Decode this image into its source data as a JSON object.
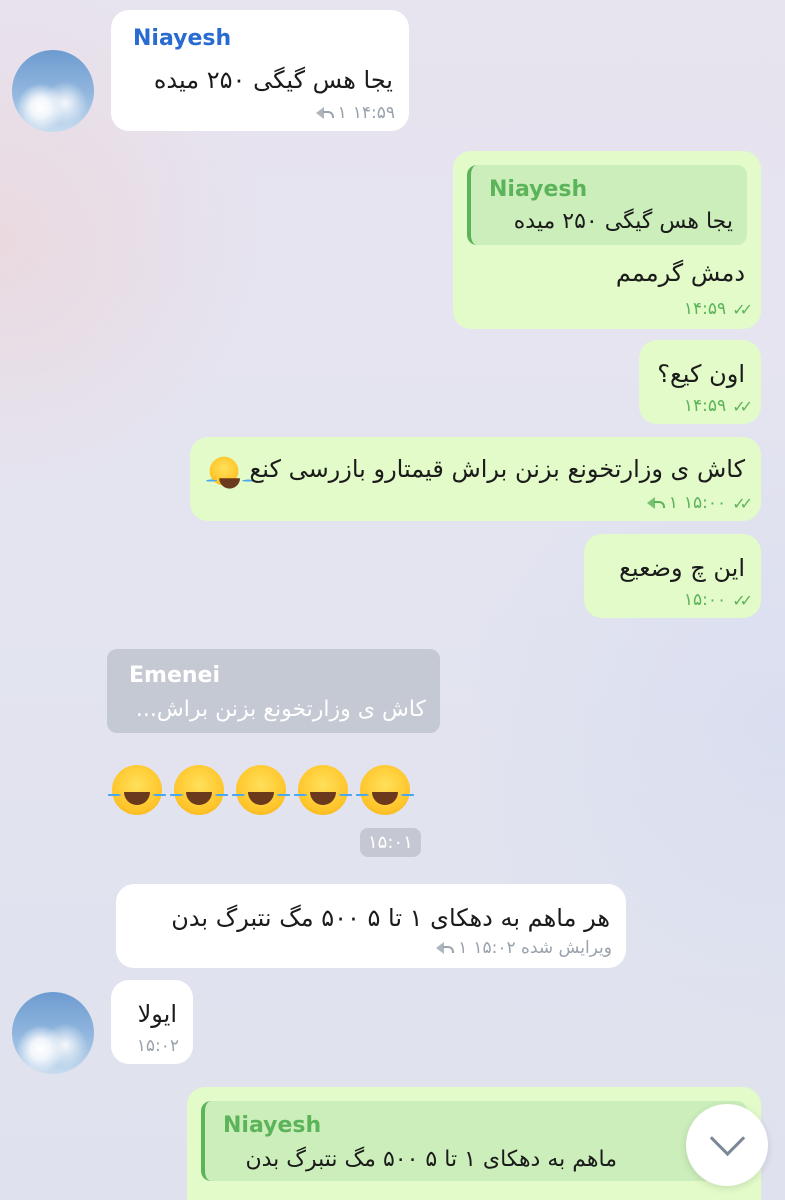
{
  "colors": {
    "incoming_bg": "#ffffff",
    "outgoing_bg": "#e2fbc8",
    "sender_name": "#2a6bd1",
    "quote_green": "#5cb45a"
  },
  "messages": [
    {
      "sender": "Niayesh",
      "text": "یجا هس گیگی ۲۵۰ میده",
      "meta": "۱۴:۵۹",
      "replies": "۱"
    },
    {
      "quote": {
        "name": "Niayesh",
        "text": "یجا هس گیگی ۲۵۰ میده"
      },
      "text": "دمش گرممم",
      "meta": "۱۴:۵۹"
    },
    {
      "text": "اون کیع؟",
      "meta": "۱۴:۵۹"
    },
    {
      "text": "کاش ی وزارتخونع بزنن براش قیمتارو بازرسی کنع",
      "meta": "۱۵:۰۰",
      "replies": "۱"
    },
    {
      "text": "این چ وضعیع",
      "meta": "۱۵:۰۰"
    },
    {
      "quote": {
        "name": "Emenei",
        "text": "کاش ی وزارتخونع بزنن براش..."
      },
      "emoji_count": 5,
      "meta": "۱۵:۰۱"
    },
    {
      "text": "هر ماهم به دهکای ۱ تا ۵  ۵۰۰ مگ نتبرگ بدن",
      "meta": "ویرایش شده ۱۵:۰۲",
      "replies": "۱"
    },
    {
      "text": "ایولا",
      "meta": "۱۵:۰۲"
    },
    {
      "quote": {
        "name": "Niayesh",
        "text": "ماهم به دهکای ۱ تا ۵  ۵۰۰ مگ نتبرگ بدن"
      }
    }
  ],
  "icons": {
    "double_check": "✓✓",
    "reply": "reply-icon",
    "scroll_down": "chevron-down-icon"
  }
}
